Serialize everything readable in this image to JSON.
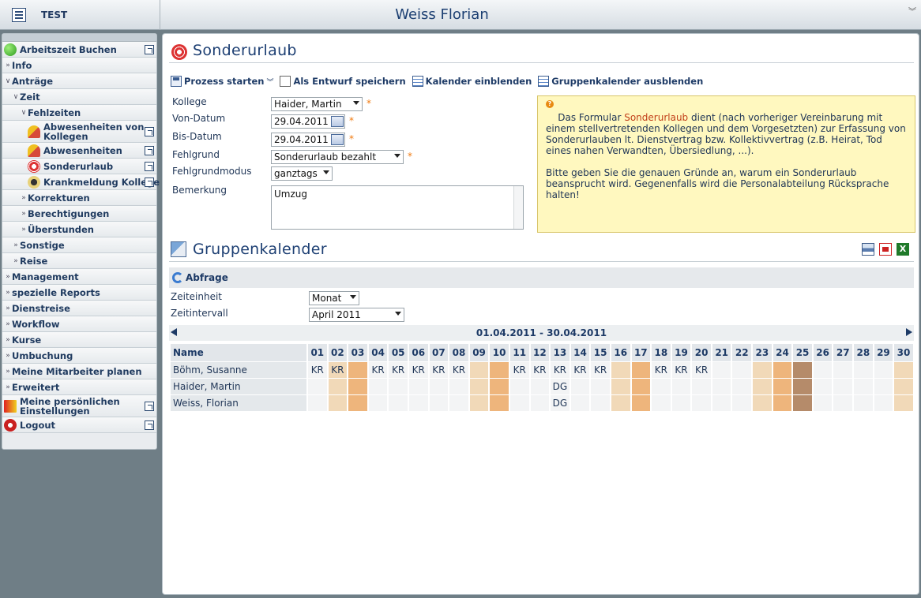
{
  "topbar": {
    "app_name": "TEST",
    "user_name": "Weiss Florian"
  },
  "sidebar": {
    "items": [
      {
        "label": "Arbeitszeit Buchen",
        "icon": "green-dot-icon",
        "indent": 0
      },
      {
        "label": "Info",
        "indent": 0
      },
      {
        "label": "Anträge",
        "indent": 0
      },
      {
        "label": "Zeit",
        "indent": 1
      },
      {
        "label": "Fehlzeiten",
        "indent": 2
      },
      {
        "label": "Abwesenheiten von Kollegen",
        "icon": "umbrella-icon",
        "indent": 3
      },
      {
        "label": "Abwesenheiten",
        "icon": "umbrella-icon",
        "indent": 3
      },
      {
        "label": "Sonderurlaub",
        "icon": "lifering-icon",
        "indent": 3
      },
      {
        "label": "Krankmeldung Kollege",
        "icon": "bug-icon",
        "indent": 3
      },
      {
        "label": "Korrekturen",
        "indent": 2
      },
      {
        "label": "Berechtigungen",
        "indent": 2
      },
      {
        "label": "Überstunden",
        "indent": 2
      },
      {
        "label": "Sonstige",
        "indent": 1
      },
      {
        "label": "Reise",
        "indent": 1
      },
      {
        "label": "Management",
        "indent": 0
      },
      {
        "label": "spezielle Reports",
        "indent": 0
      },
      {
        "label": "Dienstreise",
        "indent": 0
      },
      {
        "label": "Workflow",
        "indent": 0
      },
      {
        "label": "Kurse",
        "indent": 0
      },
      {
        "label": "Umbuchung",
        "indent": 0
      },
      {
        "label": "Meine Mitarbeiter planen",
        "indent": 0
      },
      {
        "label": "Erweitert",
        "indent": 0
      },
      {
        "label": "Meine persönlichen Einstellungen",
        "icon": "settings-icon",
        "indent": 0
      },
      {
        "label": "Logout",
        "icon": "power-icon",
        "indent": 0
      }
    ]
  },
  "page": {
    "title": "Sonderurlaub",
    "toolbar": {
      "start_process": "Prozess starten",
      "save_draft": "Als Entwurf speichern",
      "show_calendar": "Kalender einblenden",
      "hide_group_calendar": "Gruppenkalender ausblenden"
    },
    "form": {
      "kollege_label": "Kollege",
      "kollege_value": "Haider, Martin",
      "von_label": "Von-Datum",
      "von_value": "29.04.2011",
      "bis_label": "Bis-Datum",
      "bis_value": "29.04.2011",
      "grund_label": "Fehlgrund",
      "grund_value": "Sonderurlaub bezahlt",
      "modus_label": "Fehlgrundmodus",
      "modus_value": "ganztags",
      "bemerkung_label": "Bemerkung",
      "bemerkung_value": "Umzug",
      "required_mark": "*"
    },
    "hint": {
      "q": "?",
      "pre": "Das Formular",
      "link": "Sonderurlaub",
      "post": "dient (nach vorheriger Vereinbarung mit einem stellvertretenden Kollegen und dem Vorgesetzten) zur Erfassung von Sonderurlauben lt. Dienstvertrag bzw. Kollektivvertrag (z.B. Heirat, Tod eines nahen Verwandten, Übersiedlung, ...).",
      "para2": "Bitte geben Sie die genauen Gründe an, warum ein Sonderurlaub beansprucht wird. Gegenenfalls wird die Personalabteilung Rücksprache halten!"
    }
  },
  "group_calendar": {
    "title": "Gruppenkalender",
    "query_label": "Abfrage",
    "zeiteinheit_label": "Zeiteinheit",
    "zeiteinheit_value": "Monat",
    "zeitintervall_label": "Zeitintervall",
    "zeitintervall_value": "April 2011",
    "range": "01.04.2011 - 30.04.2011",
    "name_header": "Name",
    "days": [
      "01",
      "02",
      "03",
      "04",
      "05",
      "06",
      "07",
      "08",
      "09",
      "10",
      "11",
      "12",
      "13",
      "14",
      "15",
      "16",
      "17",
      "18",
      "19",
      "20",
      "21",
      "22",
      "23",
      "24",
      "25",
      "26",
      "27",
      "28",
      "29",
      "30"
    ],
    "day_colors": {
      "light": "#f1d9b8",
      "mid": "#eeb57c",
      "dark": "#b58b6a"
    },
    "day_types": [
      "",
      "light",
      "mid",
      "",
      "",
      "",
      "",
      "",
      "light",
      "mid",
      "",
      "",
      "",
      "",
      "",
      "light",
      "mid",
      "",
      "",
      "",
      "",
      "",
      "light",
      "mid",
      "dark",
      "",
      "",
      "",
      "",
      "light"
    ],
    "rows": [
      {
        "name": "Böhm, Susanne",
        "cells": [
          "KR",
          "KR",
          "",
          "KR",
          "KR",
          "KR",
          "KR",
          "KR",
          "",
          "",
          "KR",
          "KR",
          "KR",
          "KR",
          "KR",
          "",
          "",
          "KR",
          "KR",
          "KR",
          "",
          "",
          "",
          "",
          "",
          "",
          "",
          "",
          "",
          ""
        ]
      },
      {
        "name": "Haider, Martin",
        "cells": [
          "",
          "",
          "",
          "",
          "",
          "",
          "",
          "",
          "",
          "",
          "",
          "",
          "DG",
          "",
          "",
          "",
          "",
          "",
          "",
          "",
          "",
          "",
          "",
          "",
          "",
          "",
          "",
          "",
          "",
          ""
        ]
      },
      {
        "name": "Weiss, Florian",
        "cells": [
          "",
          "",
          "",
          "",
          "",
          "",
          "",
          "",
          "",
          "",
          "",
          "",
          "DG",
          "",
          "",
          "",
          "",
          "",
          "",
          "",
          "",
          "",
          "",
          "",
          "",
          "",
          "",
          "",
          "",
          ""
        ]
      }
    ]
  }
}
